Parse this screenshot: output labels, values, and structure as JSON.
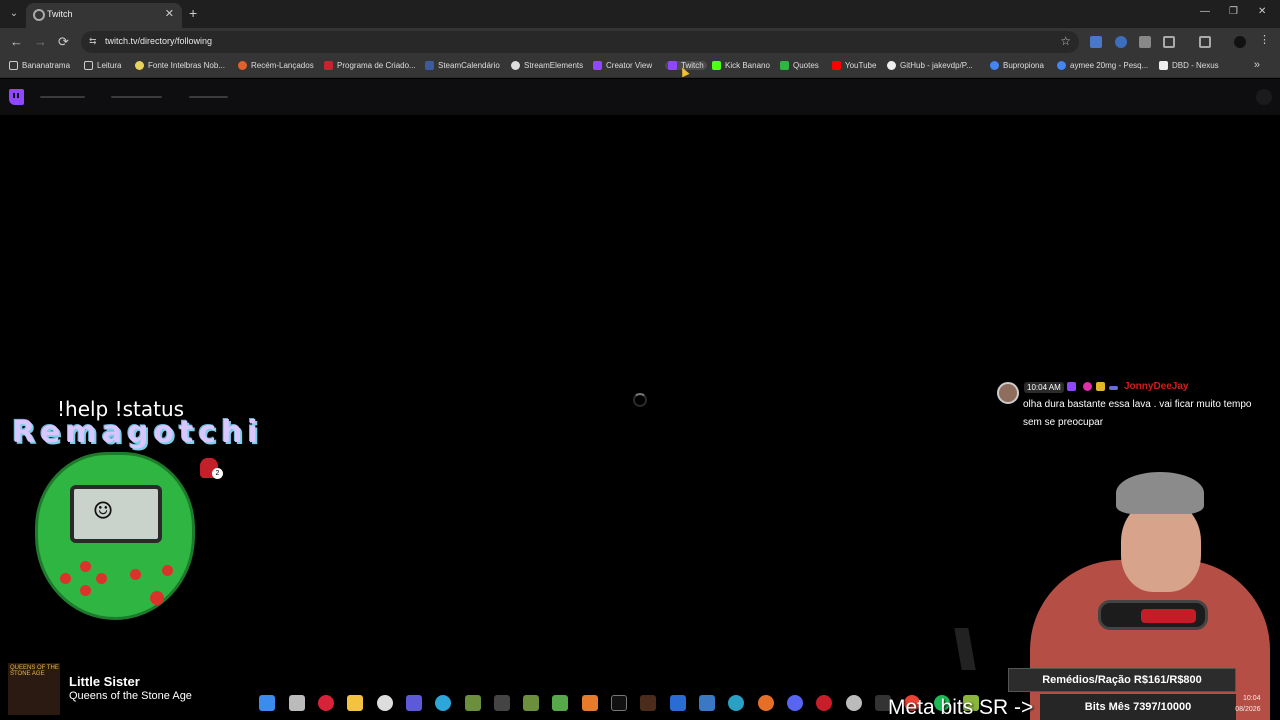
{
  "browser": {
    "tab_title": "Twitch",
    "url": "twitch.tv/directory/following",
    "tab_close": "✕",
    "new_tab": "+",
    "window_controls": [
      "—",
      "❐",
      "✕"
    ],
    "nav": {
      "back": "←",
      "forward": "→",
      "reload": "⟳"
    },
    "star": "☆",
    "site_info": "⇆",
    "more": "»"
  },
  "bookmarks": [
    {
      "label": "Bananatrama",
      "icon": "folder-icon"
    },
    {
      "label": "Leitura",
      "icon": "folder-icon"
    },
    {
      "label": "Fonte Intelbras Nob...",
      "icon": "tag-icon"
    },
    {
      "label": "Recém-Lançados",
      "icon": "orange-icon"
    },
    {
      "label": "Programa de Criado...",
      "icon": "red-icon"
    },
    {
      "label": "SteamCalendário",
      "icon": "steam-icon"
    },
    {
      "label": "StreamElements",
      "icon": "anchor-icon"
    },
    {
      "label": "Creator View",
      "icon": "twitch-icon"
    },
    {
      "label": "Twitch",
      "icon": "twitch-icon"
    },
    {
      "label": "Kick Banano",
      "icon": "kick-icon"
    },
    {
      "label": "Quotes",
      "icon": "quotes-icon"
    },
    {
      "label": "YouTube",
      "icon": "youtube-icon"
    },
    {
      "label": "GitHub - jakevdp/P...",
      "icon": "github-icon"
    },
    {
      "label": "Bupropiona",
      "icon": "google-icon"
    },
    {
      "label": "aymee 20mg - Pesq...",
      "icon": "google-icon"
    },
    {
      "label": "DBD - Nexus",
      "icon": "nexus-icon"
    }
  ],
  "overlay": {
    "help_text": "!help !status",
    "title_text": "Remagotchi",
    "red_badge": "2",
    "now_playing": {
      "art_text": "QUEENS OF THE STONE AGE",
      "song": "Little Sister",
      "artist": "Queens of the Stone Age"
    },
    "chat": {
      "time": "10:04 AM",
      "user": "JonnyDeeJay",
      "message": "olha dura bastante essa lava . vai ficar muito tempo sem se preocupar"
    },
    "goal_remedios": "Remédios/Ração R$161/R$800",
    "goal_bits": "Bits Mês 7397/10000",
    "meta_bits": "Meta bits SR ->"
  },
  "taskbar": {
    "clock_time": "10:04",
    "clock_date": "08/2026"
  },
  "colors": {
    "twitch_purple": "#9146ff",
    "chat_user": "#d41d1d",
    "toy_green": "#2fb542"
  }
}
